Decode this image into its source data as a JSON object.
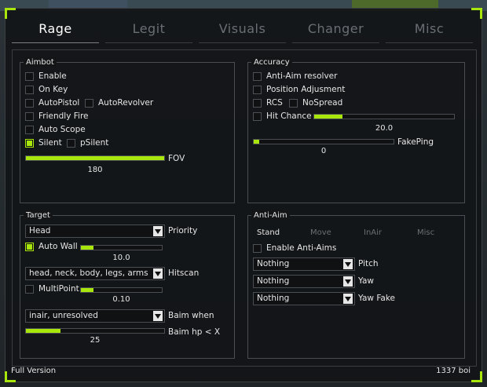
{
  "tabs": [
    "Rage",
    "Legit",
    "Visuals",
    "Changer",
    "Misc"
  ],
  "colors": {
    "accent": "#a8e60c",
    "panel": "#131517",
    "border": "#4a4e52"
  },
  "aimbot": {
    "title": "Aimbot",
    "enable": "Enable",
    "on_key": "On Key",
    "autopistol": "AutoPistol",
    "autorevolver": "AutoRevolver",
    "friendly_fire": "Friendly Fire",
    "auto_scope": "Auto Scope",
    "silent": "Silent",
    "psilent": "pSilent",
    "fov_label": "FOV",
    "fov_value": "180",
    "fov_fraction": 1.0
  },
  "accuracy": {
    "title": "Accuracy",
    "anti_aim_resolver": "Anti-Aim resolver",
    "position_adjustment": "Position Adjusment",
    "rcs": "RCS",
    "nospread": "NoSpread",
    "hit_chance": "Hit Chance",
    "hit_chance_value": "20.0",
    "hit_chance_fraction": 0.2,
    "fakeping_label": "FakePing",
    "fakeping_value": "0",
    "fakeping_fraction": 0.0
  },
  "target": {
    "title": "Target",
    "priority_value": "Head",
    "priority_label": "Priority",
    "auto_wall": "Auto Wall",
    "auto_wall_value": "10.0",
    "auto_wall_fraction": 0.1,
    "hitscan_value": "head, neck, body, legs, arms",
    "hitscan_label": "Hitscan",
    "multipoint": "MultiPoint",
    "multipoint_value": "0.10",
    "multipoint_fraction": 0.1,
    "baim_value": "inair, unresolved",
    "baim_label": "Baim when",
    "baim_hp_label": "Baim hp < X",
    "baim_hp_value": "25",
    "baim_hp_fraction": 0.25
  },
  "antiaim": {
    "title": "Anti-Aim",
    "subtabs": [
      "Stand",
      "Move",
      "InAir",
      "Misc"
    ],
    "enable": "Enable Anti-Aims",
    "pitch_value": "Nothing",
    "pitch_label": "Pitch",
    "yaw_value": "Nothing",
    "yaw_label": "Yaw",
    "yawfake_value": "Nothing",
    "yawfake_label": "Yaw Fake"
  },
  "footer": {
    "left": "Full Version",
    "right": "1337 boi"
  }
}
